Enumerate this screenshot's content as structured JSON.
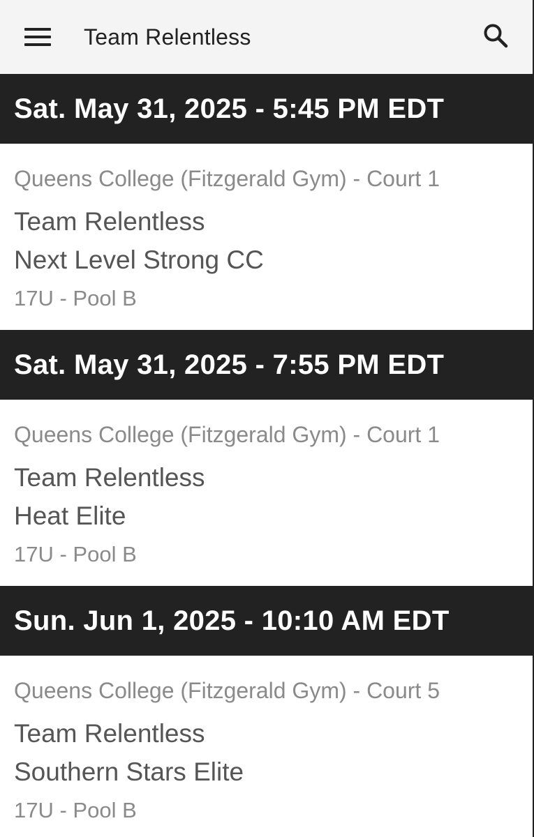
{
  "appbar": {
    "title": "Team Relentless",
    "menu_icon": "hamburger-menu-icon",
    "search_icon": "search-icon"
  },
  "games": [
    {
      "datetime": "Sat. May 31, 2025 - 5:45 PM EDT",
      "venue": "Queens College (Fitzgerald Gym) - Court 1",
      "team1": "Team Relentless",
      "team2": "Next Level Strong CC",
      "division": "17U - Pool B"
    },
    {
      "datetime": "Sat. May 31, 2025 - 7:55 PM EDT",
      "venue": "Queens College (Fitzgerald Gym) - Court 1",
      "team1": "Team Relentless",
      "team2": "Heat Elite",
      "division": "17U - Pool B"
    },
    {
      "datetime": "Sun. Jun 1, 2025 - 10:10 AM EDT",
      "venue": "Queens College (Fitzgerald Gym) - Court 5",
      "team1": "Team Relentless",
      "team2": "Southern Stars Elite",
      "division": "17U - Pool B"
    }
  ],
  "colors": {
    "appbar_bg": "#f4f4f4",
    "header_bg": "#222222",
    "header_text": "#ffffff",
    "secondary_text": "#8a8a8a",
    "primary_text": "#555555"
  }
}
